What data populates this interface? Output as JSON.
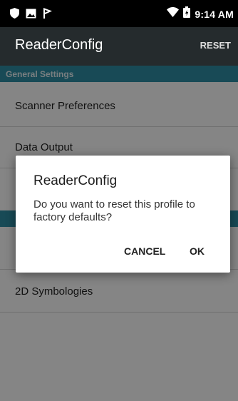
{
  "status_bar": {
    "time": "9:14 AM",
    "icons": [
      "shield-icon",
      "image-icon",
      "tag-flag-icon",
      "wifi-icon",
      "battery-icon"
    ]
  },
  "app_bar": {
    "title": "ReaderConfig",
    "action": "RESET",
    "background": "#252b2d"
  },
  "sections": [
    {
      "header": "General Settings",
      "items": [
        "Scanner Preferences",
        "Data Output"
      ]
    },
    {
      "items": [
        "2D Symbologies"
      ]
    }
  ],
  "dialog": {
    "title": "ReaderConfig",
    "message": "Do you want to reset this profile to factory defaults?",
    "cancel_label": "CANCEL",
    "ok_label": "OK"
  },
  "colors": {
    "section_header": "#2f8fa6",
    "scrim": "rgba(0,0,0,0.48)"
  }
}
